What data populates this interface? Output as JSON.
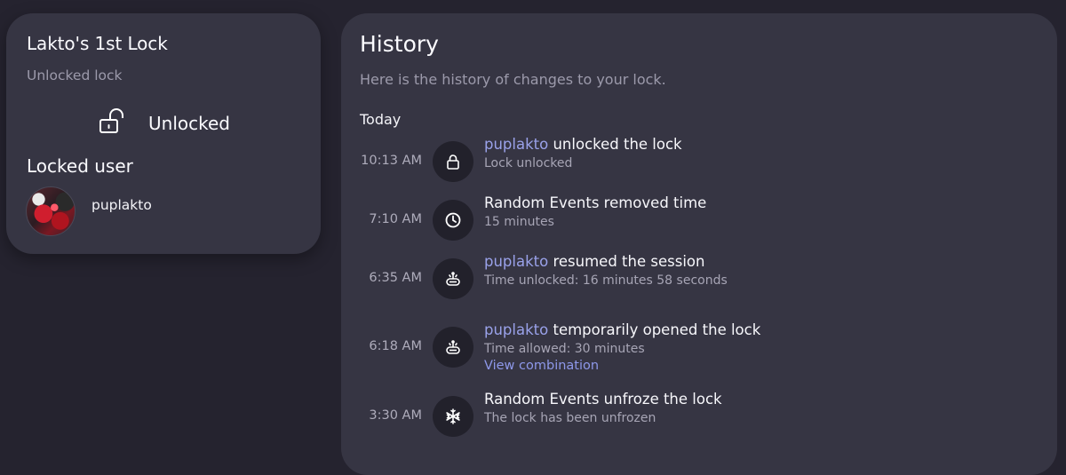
{
  "lock_card": {
    "title": "Lakto's 1st Lock",
    "subtitle": "Unlocked lock",
    "status_label": "Unlocked",
    "status_icon": "lock-open-icon",
    "locked_user_heading": "Locked user",
    "user": {
      "name": "puplakto"
    }
  },
  "history": {
    "title": "History",
    "description": "Here is the history of changes to your lock.",
    "day_label": "Today",
    "events": [
      {
        "time": "10:13 AM",
        "icon": "lock-icon",
        "actor": "puplakto",
        "action": " unlocked the lock",
        "detail": "Lock unlocked",
        "link": ""
      },
      {
        "time": "7:10 AM",
        "icon": "clock-icon",
        "actor": "",
        "action": "Random Events removed time",
        "detail": "15 minutes",
        "link": ""
      },
      {
        "time": "6:35 AM",
        "icon": "session-icon",
        "actor": "puplakto",
        "action": " resumed the session",
        "detail": "Time unlocked: 16 minutes 58 seconds",
        "link": ""
      },
      {
        "time": "6:18 AM",
        "icon": "session-icon",
        "actor": "puplakto",
        "action": " temporarily opened the lock",
        "detail": "Time allowed: 30 minutes",
        "link": "View combination"
      },
      {
        "time": "3:30 AM",
        "icon": "snowflake-icon",
        "actor": "",
        "action": "Random Events unfroze the lock",
        "detail": "The lock has been unfrozen",
        "link": ""
      }
    ]
  },
  "colors": {
    "background": "#25232f",
    "card": "#363543",
    "accent": "#9aa2ea",
    "muted_text": "#9c9aab"
  }
}
